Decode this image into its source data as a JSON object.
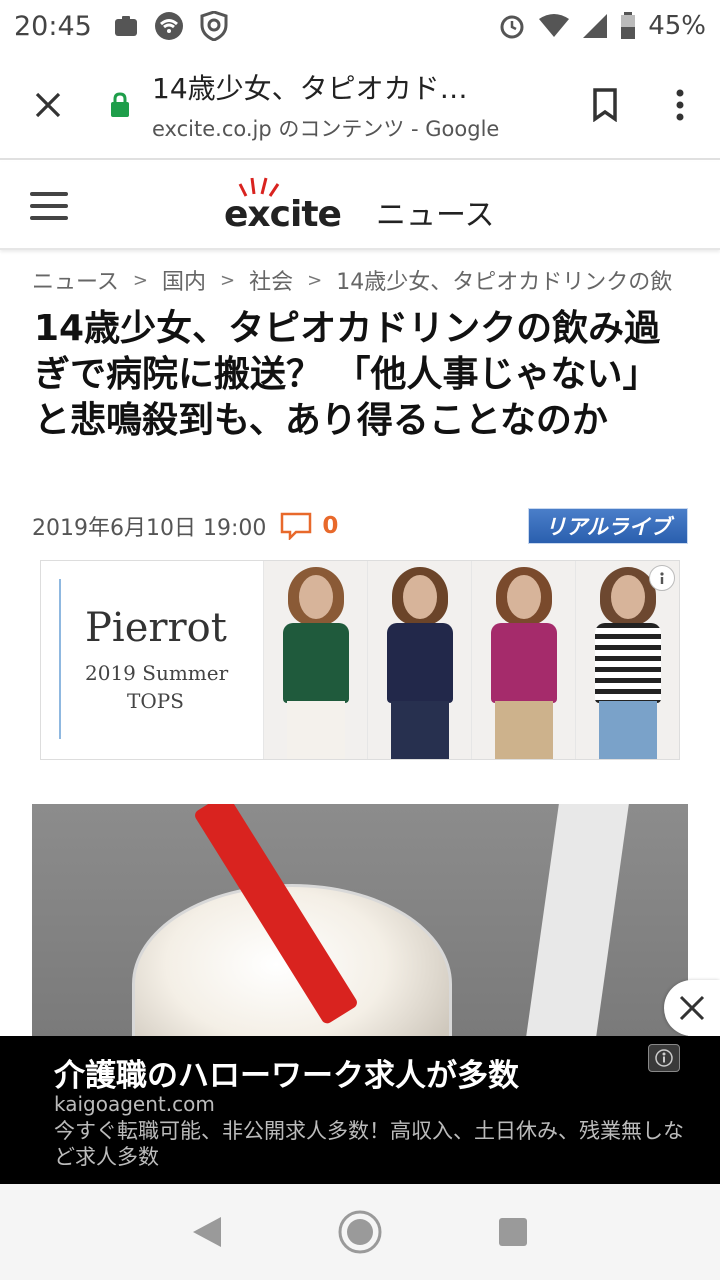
{
  "status_bar": {
    "time": "20:45",
    "battery": "45%",
    "icons": [
      "notification-icon",
      "wifi-icon",
      "vpn-shield-icon",
      "alarm-icon",
      "wifi-signal-icon",
      "cell-signal-icon",
      "battery-icon"
    ]
  },
  "tab": {
    "title": "14歳少女、タピオカド…",
    "subtitle": "excite.co.jp のコンテンツ - Google"
  },
  "site": {
    "logo": "excite",
    "section": "ニュース"
  },
  "breadcrumb": {
    "items": [
      "ニュース",
      "国内",
      "社会",
      "14歳少女、タピオカドリンクの飲"
    ],
    "separator": ">"
  },
  "article": {
    "title": "14歳少女、タピオカドリンクの飲み過ぎで病院に搬送？ 「他人事じゃない」と悲鳴殺到も、あり得ることなのか",
    "date": "2019年6月10日 19:00",
    "comment_count": "0",
    "source": "リアルライブ"
  },
  "ad_banner": {
    "brand": "Pierrot",
    "line2": "2019 Summer",
    "line3": "TOPS"
  },
  "bottom_ad": {
    "title": "介護職のハローワーク求人が多数",
    "url": "kaigoagent.com",
    "description": "今すぐ転職可能、非公開求人多数！高収入、土日休み、残業無しなど求人多数"
  },
  "colors": {
    "accent_orange": "#e8692b",
    "lock_green": "#1e9e4a",
    "source_blue": "#2a5fae",
    "straw_red": "#d9231f"
  }
}
